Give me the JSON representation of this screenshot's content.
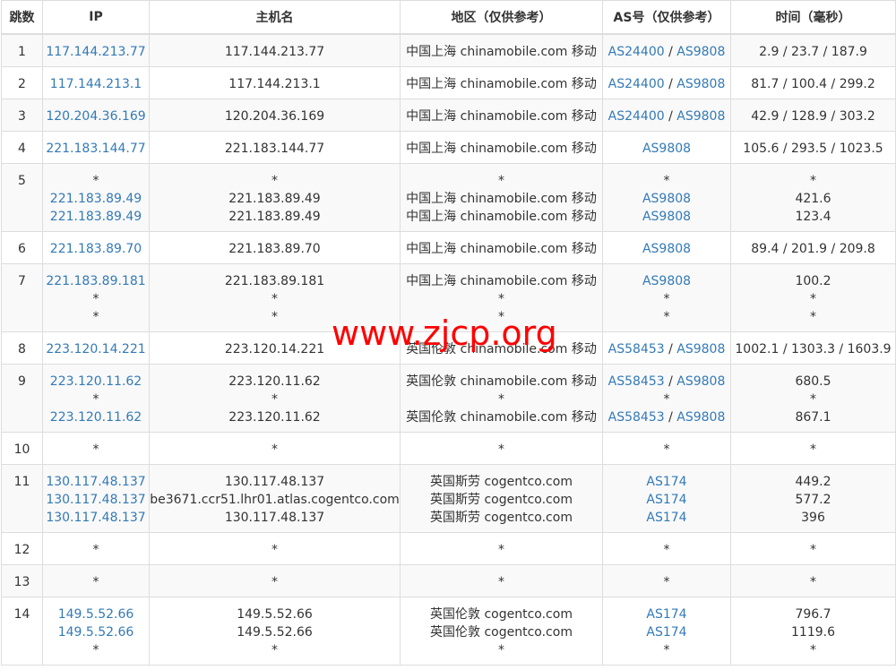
{
  "headers": [
    "跳数",
    "IP",
    "主机名",
    "地区（仅供参考）",
    "AS号（仅供参考）",
    "时间（毫秒）"
  ],
  "watermark": "www.zjcp.org",
  "rows": [
    {
      "hop": "1",
      "ips": [
        "117.144.213.77"
      ],
      "hosts": [
        "117.144.213.77"
      ],
      "regions": [
        "中国上海 chinamobile.com 移动"
      ],
      "as": [
        [
          "AS24400",
          "AS9808"
        ]
      ],
      "times": [
        "2.9 / 23.7 / 187.9"
      ]
    },
    {
      "hop": "2",
      "ips": [
        "117.144.213.1"
      ],
      "hosts": [
        "117.144.213.1"
      ],
      "regions": [
        "中国上海 chinamobile.com 移动"
      ],
      "as": [
        [
          "AS24400",
          "AS9808"
        ]
      ],
      "times": [
        "81.7 / 100.4 / 299.2"
      ]
    },
    {
      "hop": "3",
      "ips": [
        "120.204.36.169"
      ],
      "hosts": [
        "120.204.36.169"
      ],
      "regions": [
        "中国上海 chinamobile.com 移动"
      ],
      "as": [
        [
          "AS24400",
          "AS9808"
        ]
      ],
      "times": [
        "42.9 / 128.9 / 303.2"
      ]
    },
    {
      "hop": "4",
      "ips": [
        "221.183.144.77"
      ],
      "hosts": [
        "221.183.144.77"
      ],
      "regions": [
        "中国上海 chinamobile.com 移动"
      ],
      "as": [
        [
          "AS9808"
        ]
      ],
      "times": [
        "105.6 / 293.5 / 1023.5"
      ]
    },
    {
      "hop": "5",
      "ips": [
        "*",
        "221.183.89.49",
        "221.183.89.49"
      ],
      "hosts": [
        "*",
        "221.183.89.49",
        "221.183.89.49"
      ],
      "regions": [
        "*",
        "中国上海 chinamobile.com 移动",
        "中国上海 chinamobile.com 移动"
      ],
      "as": [
        [
          "*"
        ],
        [
          "AS9808"
        ],
        [
          "AS9808"
        ]
      ],
      "times": [
        "*",
        "421.6",
        "123.4"
      ]
    },
    {
      "hop": "6",
      "ips": [
        "221.183.89.70"
      ],
      "hosts": [
        "221.183.89.70"
      ],
      "regions": [
        "中国上海 chinamobile.com 移动"
      ],
      "as": [
        [
          "AS9808"
        ]
      ],
      "times": [
        "89.4 / 201.9 / 209.8"
      ]
    },
    {
      "hop": "7",
      "ips": [
        "221.183.89.181",
        "*",
        "*"
      ],
      "hosts": [
        "221.183.89.181",
        "*",
        "*"
      ],
      "regions": [
        "中国上海 chinamobile.com 移动",
        "*",
        "*"
      ],
      "as": [
        [
          "AS9808"
        ],
        [
          "*"
        ],
        [
          "*"
        ]
      ],
      "times": [
        "100.2",
        "*",
        "*"
      ]
    },
    {
      "hop": "8",
      "ips": [
        "223.120.14.221"
      ],
      "hosts": [
        "223.120.14.221"
      ],
      "regions": [
        "英国伦敦 chinamobile.com 移动"
      ],
      "as": [
        [
          "AS58453",
          "AS9808"
        ]
      ],
      "times": [
        "1002.1 / 1303.3 / 1603.9"
      ]
    },
    {
      "hop": "9",
      "ips": [
        "223.120.11.62",
        "*",
        "223.120.11.62"
      ],
      "hosts": [
        "223.120.11.62",
        "*",
        "223.120.11.62"
      ],
      "regions": [
        "英国伦敦 chinamobile.com 移动",
        "*",
        "英国伦敦 chinamobile.com 移动"
      ],
      "as": [
        [
          "AS58453",
          "AS9808"
        ],
        [
          "*"
        ],
        [
          "AS58453",
          "AS9808"
        ]
      ],
      "times": [
        "680.5",
        "*",
        "867.1"
      ]
    },
    {
      "hop": "10",
      "ips": [
        "*"
      ],
      "hosts": [
        "*"
      ],
      "regions": [
        "*"
      ],
      "as": [
        [
          "*"
        ]
      ],
      "times": [
        "*"
      ]
    },
    {
      "hop": "11",
      "ips": [
        "130.117.48.137",
        "130.117.48.137",
        "130.117.48.137"
      ],
      "hosts": [
        "130.117.48.137",
        "be3671.ccr51.lhr01.atlas.cogentco.com",
        "130.117.48.137"
      ],
      "regions": [
        "英国斯劳 cogentco.com",
        "英国斯劳 cogentco.com",
        "英国斯劳 cogentco.com"
      ],
      "as": [
        [
          "AS174"
        ],
        [
          "AS174"
        ],
        [
          "AS174"
        ]
      ],
      "times": [
        "449.2",
        "577.2",
        "396"
      ]
    },
    {
      "hop": "12",
      "ips": [
        "*"
      ],
      "hosts": [
        "*"
      ],
      "regions": [
        "*"
      ],
      "as": [
        [
          "*"
        ]
      ],
      "times": [
        "*"
      ]
    },
    {
      "hop": "13",
      "ips": [
        "*"
      ],
      "hosts": [
        "*"
      ],
      "regions": [
        "*"
      ],
      "as": [
        [
          "*"
        ]
      ],
      "times": [
        "*"
      ]
    },
    {
      "hop": "14",
      "ips": [
        "149.5.52.66",
        "149.5.52.66",
        "*"
      ],
      "hosts": [
        "149.5.52.66",
        "149.5.52.66",
        "*"
      ],
      "regions": [
        "英国伦敦 cogentco.com",
        "英国伦敦 cogentco.com",
        "*"
      ],
      "as": [
        [
          "AS174"
        ],
        [
          "AS174"
        ],
        [
          "*"
        ]
      ],
      "times": [
        "796.7",
        "1119.6",
        "*"
      ]
    }
  ]
}
